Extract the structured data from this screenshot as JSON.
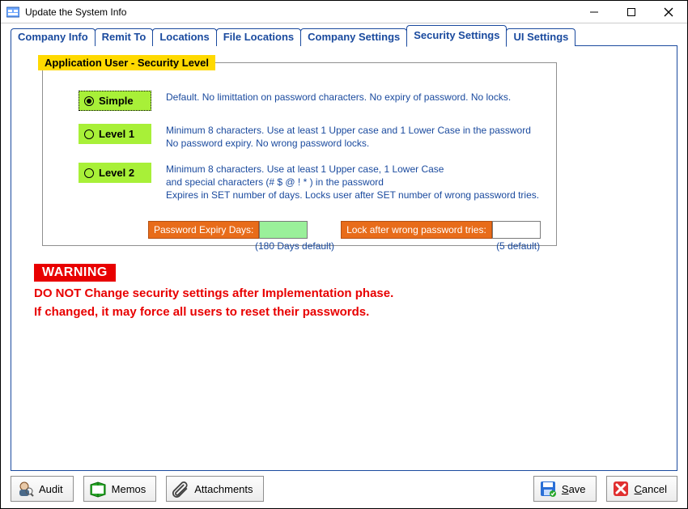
{
  "window": {
    "title": "Update the System Info"
  },
  "tabs": [
    {
      "label": "Company Info"
    },
    {
      "label": "Remit To"
    },
    {
      "label": "Locations"
    },
    {
      "label": "File Locations"
    },
    {
      "label": "Company Settings"
    },
    {
      "label": "Security Settings"
    },
    {
      "label": "UI Settings"
    }
  ],
  "fieldset": {
    "legend": "Application User - Security Level",
    "options": [
      {
        "label": "Simple",
        "desc1": "Default. No limittation on password characters. No expiry of password. No locks."
      },
      {
        "label": "Level 1",
        "desc1": "Minimum 8 characters. Use at least 1 Upper case and 1 Lower Case in the password",
        "desc2": "No password expiry. No wrong password locks."
      },
      {
        "label": "Level 2",
        "desc1": "Minimum 8 characters. Use at least 1 Upper case, 1 Lower Case",
        "desc2": "and special characters (# $ @ ! * )  in the password",
        "desc3": "Expires in SET number of days. Locks user after SET number of wrong password tries."
      }
    ],
    "expiry": {
      "expiry_label": "Password Expiry Days:",
      "expiry_value": "",
      "expiry_hint": "(180 Days default)",
      "lock_label": "Lock after wrong password tries:",
      "lock_value": "",
      "lock_hint": "(5 default)"
    }
  },
  "warning": {
    "badge": "WARNING",
    "line1": "DO NOT Change security settings after Implementation phase.",
    "line2": "If changed, it may force all users to reset their passwords."
  },
  "footer": {
    "audit": "Audit",
    "memos": "Memos",
    "attachments": "Attachments",
    "save_pre": "",
    "save_mn": "S",
    "save_post": "ave",
    "cancel_pre": "",
    "cancel_mn": "C",
    "cancel_post": "ancel"
  }
}
